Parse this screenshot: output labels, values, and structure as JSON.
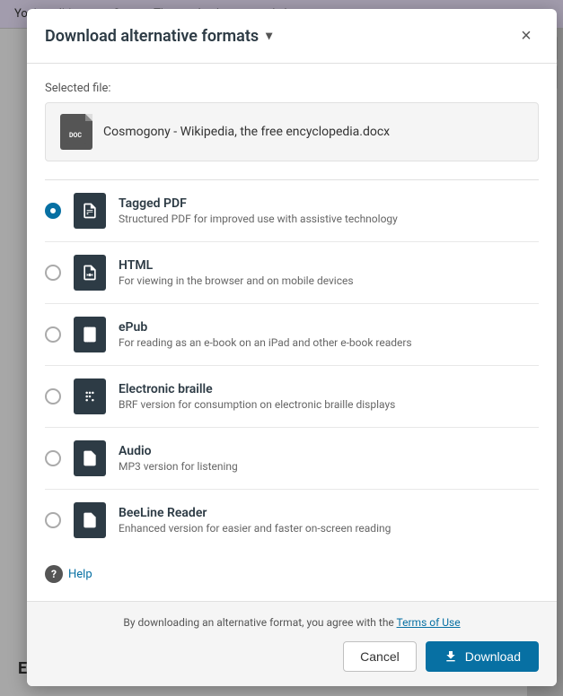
{
  "topbar": {
    "text": "You're editing your Canvas Theme. Apply or cancel changes"
  },
  "modal": {
    "title": "Download alternative formats",
    "close_label": "×",
    "selected_file_label": "Selected file:",
    "selected_file_name": "Cosmogony - Wikipedia, the free encyclopedia.docx",
    "formats": [
      {
        "id": "tagged-pdf",
        "name": "Tagged PDF",
        "description": "Structured PDF for improved use with assistive technology",
        "selected": true,
        "icon": "pdf"
      },
      {
        "id": "html",
        "name": "HTML",
        "description": "For viewing in the browser and on mobile devices",
        "selected": false,
        "icon": "html"
      },
      {
        "id": "epub",
        "name": "ePub",
        "description": "For reading as an e-book on an iPad and other e-book readers",
        "selected": false,
        "icon": "epub"
      },
      {
        "id": "electronic-braille",
        "name": "Electronic braille",
        "description": "BRF version for consumption on electronic braille displays",
        "selected": false,
        "icon": "braille"
      },
      {
        "id": "audio",
        "name": "Audio",
        "description": "MP3 version for listening",
        "selected": false,
        "icon": "audio"
      },
      {
        "id": "beeline-reader",
        "name": "BeeLine Reader",
        "description": "Enhanced version for easier and faster on-screen reading",
        "selected": false,
        "icon": "beeline"
      }
    ],
    "help_label": "Help",
    "footer": {
      "terms_text_before": "By downloading an alternative format, you agree with the ",
      "terms_link_text": "Terms of Use",
      "terms_text_after": ""
    },
    "cancel_label": "Cancel",
    "download_label": "Download"
  },
  "background": {
    "bottom_heading": "Etymology"
  }
}
